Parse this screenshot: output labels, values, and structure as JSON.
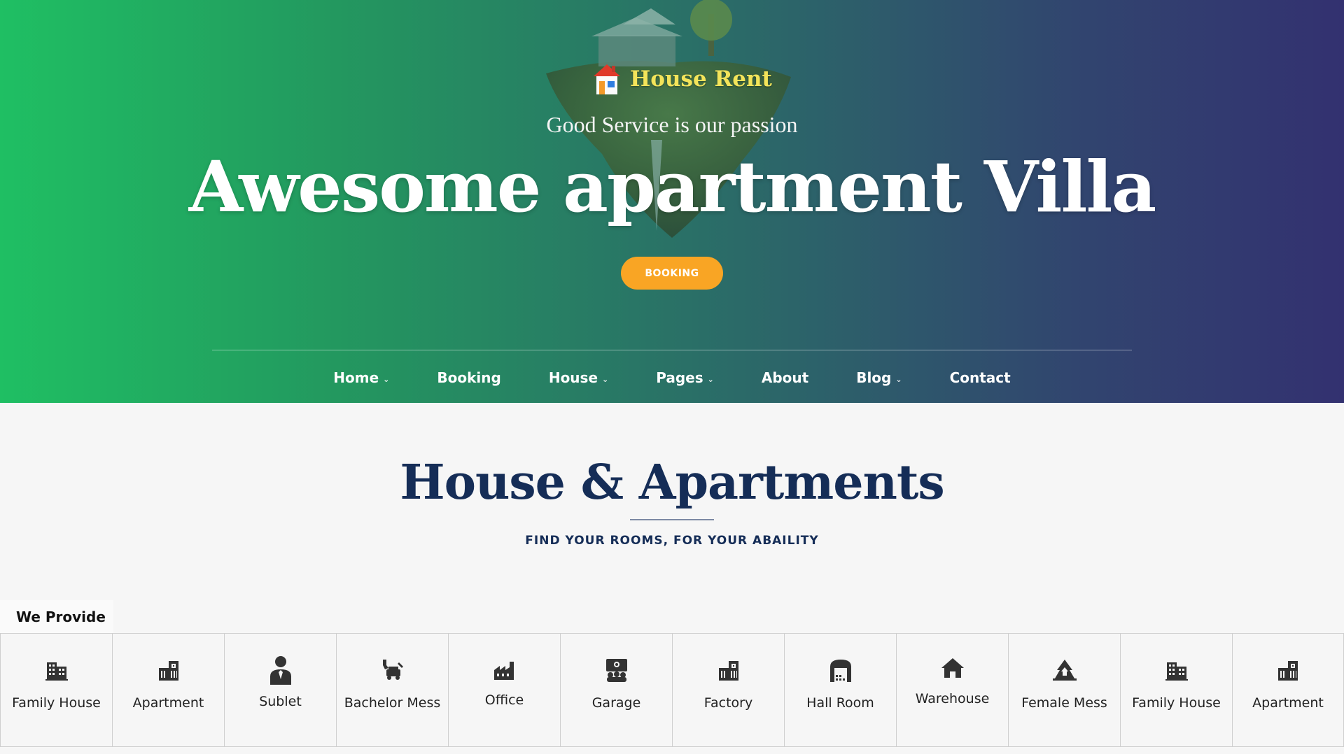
{
  "hero": {
    "logo_text": "House Rent",
    "tagline": "Good Service is our passion",
    "headline": "Awesome apartment Villa",
    "booking_button": "BOOKING"
  },
  "nav": [
    {
      "label": "Home",
      "dropdown": true
    },
    {
      "label": "Booking",
      "dropdown": false
    },
    {
      "label": "House",
      "dropdown": true
    },
    {
      "label": "Pages",
      "dropdown": true
    },
    {
      "label": "About",
      "dropdown": false
    },
    {
      "label": "Blog",
      "dropdown": true
    },
    {
      "label": "Contact",
      "dropdown": false
    }
  ],
  "section": {
    "title": "House & Apartments",
    "subtitle": "FIND YOUR ROOMS, FOR YOUR ABAILITY",
    "tab_label": "We Provide"
  },
  "categories": [
    {
      "label": "Family House",
      "icon": "building-icon"
    },
    {
      "label": "Apartment",
      "icon": "apartment-icon"
    },
    {
      "label": "Sublet",
      "icon": "person-tie-icon"
    },
    {
      "label": "Bachelor Mess",
      "icon": "tools-car-icon"
    },
    {
      "label": "Office",
      "icon": "industry-icon"
    },
    {
      "label": "Garage",
      "icon": "garage-icon"
    },
    {
      "label": "Factory",
      "icon": "apartment-icon"
    },
    {
      "label": "Hall Room",
      "icon": "warehouse-door-icon"
    },
    {
      "label": "Warehouse",
      "icon": "home-icon"
    },
    {
      "label": "Female Mess",
      "icon": "tree-house-icon"
    },
    {
      "label": "Family House",
      "icon": "building-icon"
    },
    {
      "label": "Apartment",
      "icon": "apartment-icon"
    }
  ],
  "colors": {
    "gradient_start": "#1fbf63",
    "gradient_end": "#333170",
    "accent_orange": "#f9a524",
    "logo_yellow": "#f3e45a",
    "navy": "#152d57"
  }
}
